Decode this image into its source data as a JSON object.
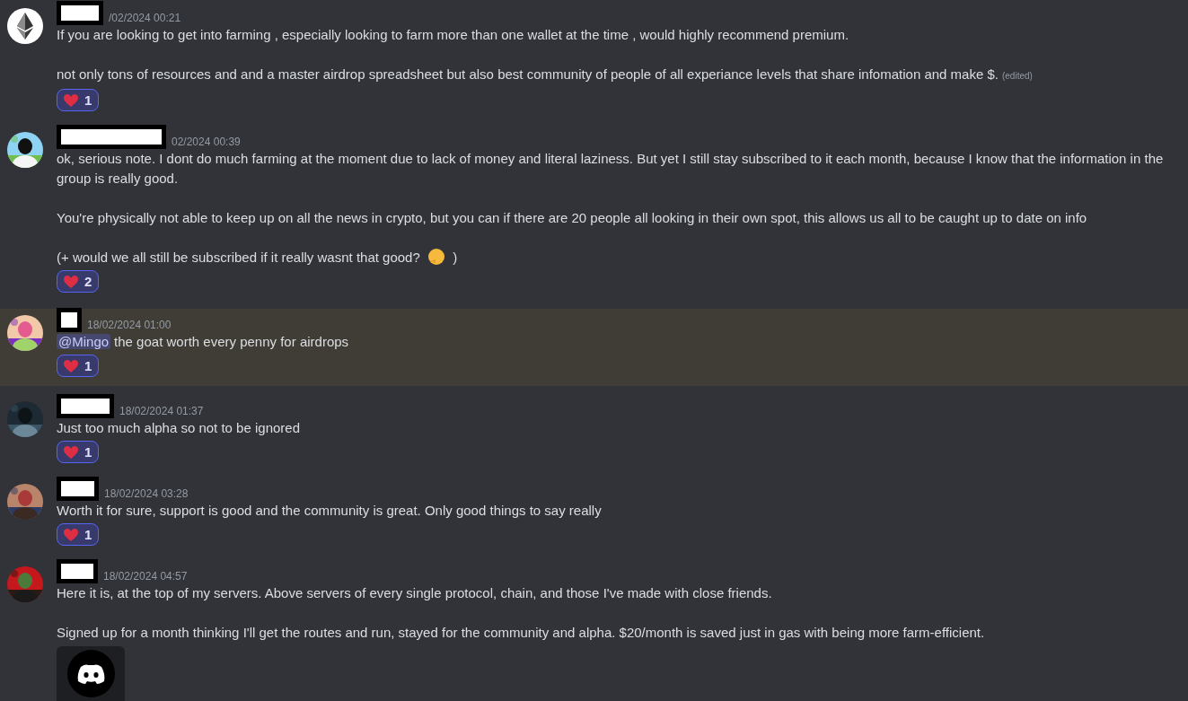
{
  "messages": [
    {
      "author": {
        "redacted": true
      },
      "avatar": {
        "kind": "logo"
      },
      "timestamp": "/02/2024 00:21",
      "highlighted": false,
      "paragraphs": [
        [
          {
            "kind": "text",
            "text": "If you are looking to get into farming , especially looking to farm more than one wallet at the time , would highly recommend premium."
          }
        ],
        [
          {
            "kind": "text",
            "text": "not only tons of resources and and a master airdrop spreadsheet but also best community of people of all experiance levels that share infomation and make $."
          },
          {
            "kind": "edited",
            "text": "(edited)"
          }
        ]
      ],
      "reactions": [
        {
          "kind": "heart",
          "count": "1",
          "selected": true
        }
      ]
    },
    {
      "author": {
        "redacted": true
      },
      "avatar": {
        "kind": "picture"
      },
      "timestamp": "02/2024 00:39",
      "highlighted": false,
      "paragraphs": [
        [
          {
            "kind": "text",
            "text": "ok, serious note. I dont do much farming at the moment due to lack of money and literal laziness. But yet I still stay subscribed to it each month, because I know that the information in the group is really good."
          }
        ],
        [
          {
            "kind": "text",
            "text": "You're physically not able to keep up on all the news in crypto, but you can if there are 20 people all looking in their own spot, this allows us all to be caught up to date on info"
          }
        ],
        [
          {
            "kind": "text",
            "text": "(+ would we all still be subscribed if it really wasnt that good?"
          },
          {
            "kind": "emoji"
          },
          {
            "kind": "text",
            "text": ")"
          }
        ]
      ],
      "reactions": [
        {
          "kind": "heart",
          "count": "2",
          "selected": true
        }
      ]
    },
    {
      "author": {
        "redacted": true
      },
      "avatar": {
        "kind": "picture"
      },
      "timestamp": "18/02/2024 01:00",
      "highlighted": true,
      "paragraphs": [
        [
          {
            "kind": "mention",
            "text": "@Mingo"
          },
          {
            "kind": "text",
            "text": "the goat worth every penny for airdrops"
          }
        ]
      ],
      "reactions": [
        {
          "kind": "heart",
          "count": "1",
          "selected": true
        }
      ]
    },
    {
      "author": {
        "redacted": true
      },
      "avatar": {
        "kind": "picture"
      },
      "timestamp": "18/02/2024 01:37",
      "highlighted": false,
      "paragraphs": [
        [
          {
            "kind": "text",
            "text": "Just too much alpha so not to be ignored"
          }
        ]
      ],
      "reactions": [
        {
          "kind": "heart",
          "count": "1",
          "selected": true
        }
      ]
    },
    {
      "author": {
        "redacted": true
      },
      "avatar": {
        "kind": "picture"
      },
      "timestamp": "18/02/2024 03:28",
      "highlighted": false,
      "paragraphs": [
        [
          {
            "kind": "text",
            "text": "Worth it for sure, support is good and the community is great. Only good things to say really"
          }
        ]
      ],
      "reactions": [
        {
          "kind": "heart",
          "count": "1",
          "selected": true
        }
      ]
    },
    {
      "author": {
        "redacted": true
      },
      "avatar": {
        "kind": "picture"
      },
      "timestamp": "18/02/2024 04:57",
      "highlighted": false,
      "paragraphs": [
        [
          {
            "kind": "text",
            "text": "Here it is, at the top of my servers. Above servers of every single protocol, chain, and those I've made with close friends."
          }
        ],
        [
          {
            "kind": "text",
            "text": "Signed up for a month thinking I'll get the routes and run, stayed for the community and alpha. $20/month is saved just in gas with being more farm-efficient."
          }
        ]
      ],
      "attachment": {
        "kind": "logo"
      }
    }
  ]
}
